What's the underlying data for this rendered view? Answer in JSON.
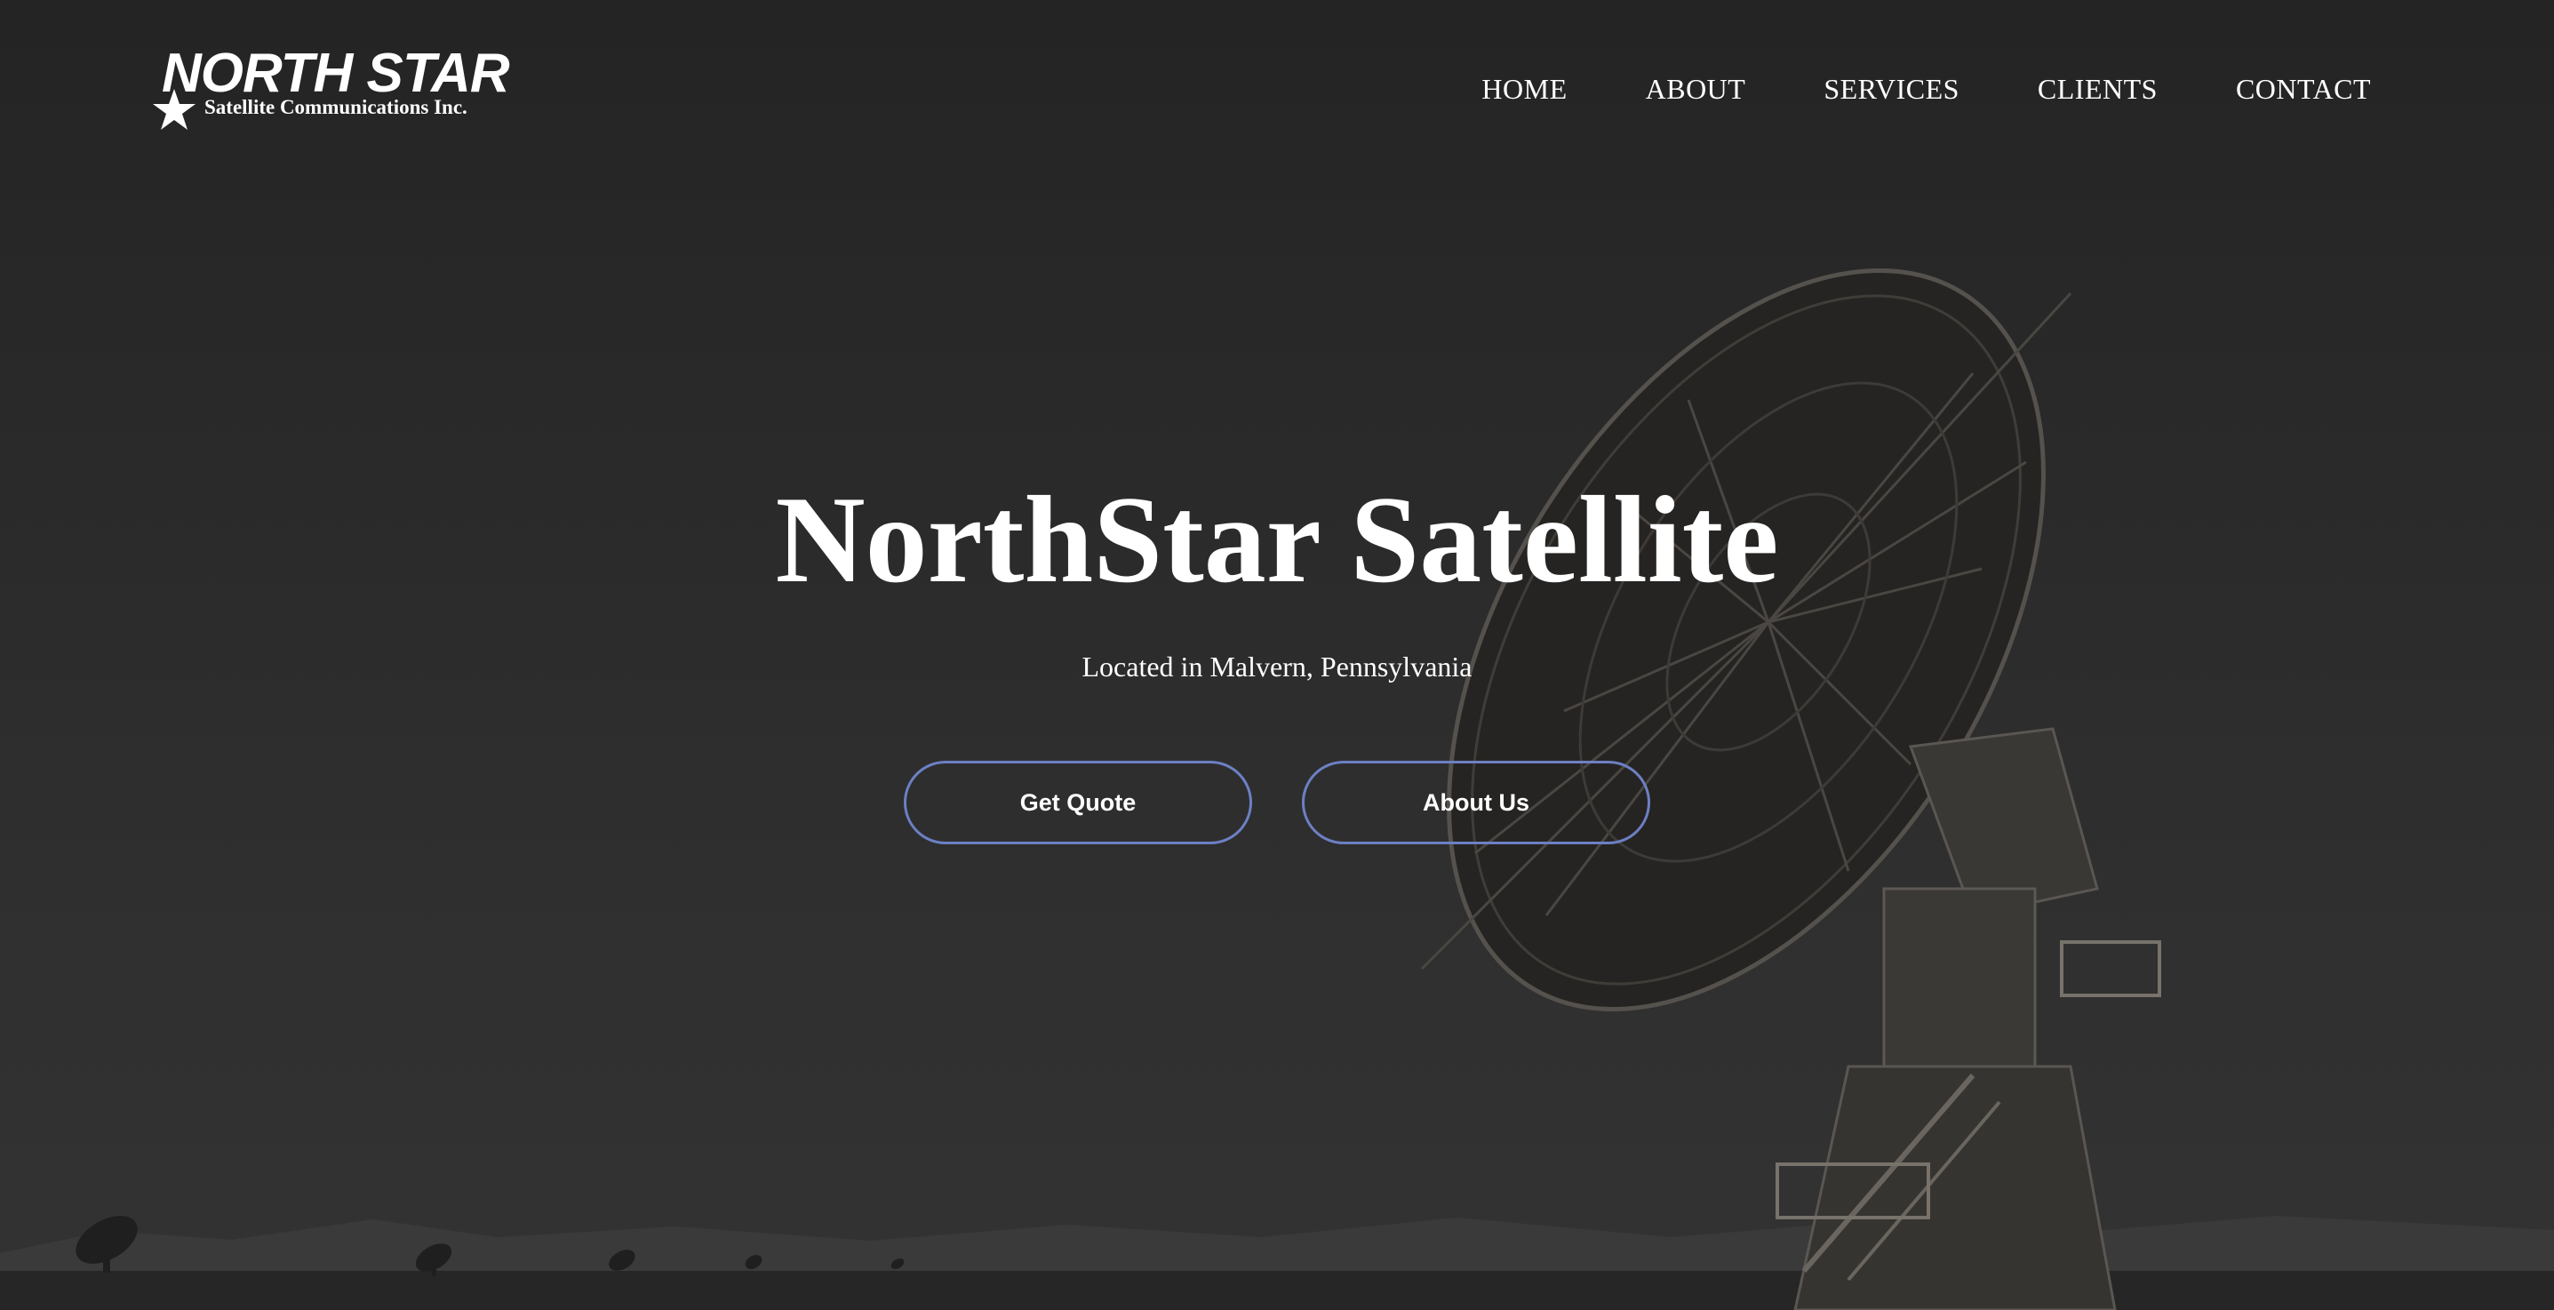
{
  "logo": {
    "title": "NORTH STAR",
    "subtitle": "Satellite Communications Inc.",
    "icon": "star-icon"
  },
  "nav": {
    "items": [
      {
        "label": "HOME"
      },
      {
        "label": "ABOUT"
      },
      {
        "label": "SERVICES"
      },
      {
        "label": "CLIENTS"
      },
      {
        "label": "CONTACT"
      }
    ]
  },
  "hero": {
    "title": "NorthStar Satellite",
    "subtitle": "Located in Malvern, Pennsylvania",
    "primary_button": "Get Quote",
    "secondary_button": "About Us",
    "background_image": "radio-telescope-dish-image"
  },
  "colors": {
    "background": "#2a2a2a",
    "text": "#ffffff",
    "button_border": "#6c80c4"
  }
}
